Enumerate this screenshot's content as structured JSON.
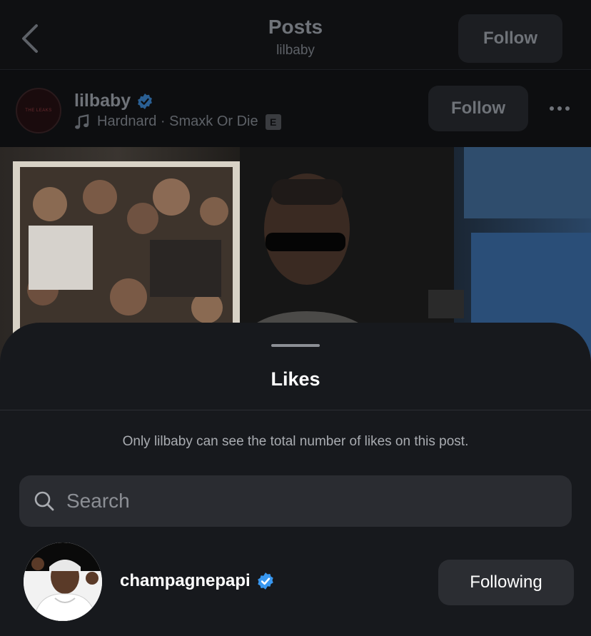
{
  "nav": {
    "back_icon": "chevron-left-icon",
    "title": "Posts",
    "subtitle": "lilbaby",
    "follow_label": "Follow"
  },
  "post_header": {
    "avatar_text": "THE LEAKS",
    "username": "lilbaby",
    "verified": true,
    "song": "Hardnard · Smaxk Or Die",
    "explicit_badge": "E",
    "follow_label": "Follow",
    "more_icon": "more-horizontal-icon"
  },
  "likes_sheet": {
    "title": "Likes",
    "info_text": "Only lilbaby can see the total number of likes on this post.",
    "search": {
      "placeholder": "Search",
      "value": ""
    },
    "users": [
      {
        "username": "champagnepapi",
        "verified": true,
        "button_label": "Following"
      }
    ]
  },
  "colors": {
    "background": "#0b0c0e",
    "sheet": "#17191d",
    "verified_blue": "#3897f0",
    "button_dark": "#2b2d32"
  }
}
